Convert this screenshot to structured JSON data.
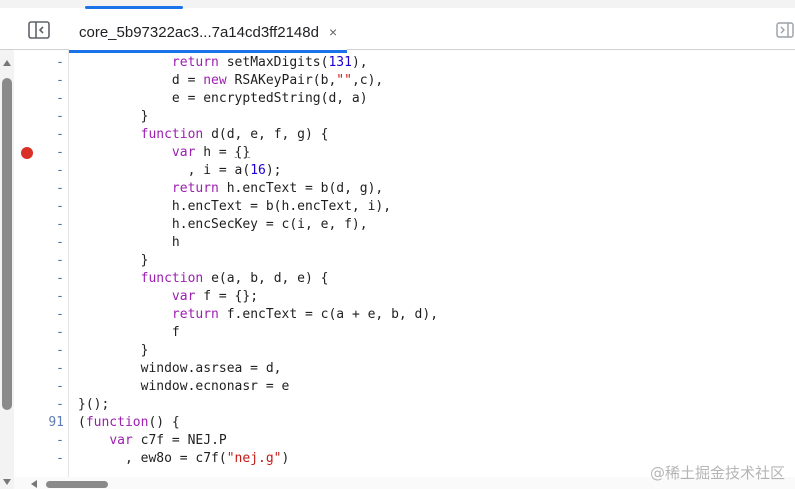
{
  "tab": {
    "file_name": "core_5b97322ac3...7a14cd3ff2148d",
    "close_glyph": "×"
  },
  "icons": {
    "nav_toggle": "sidebar-toggle-icon",
    "nav_toggle_right": "panel-toggle-icon",
    "breakpoint": "breakpoint-marker-icon"
  },
  "colors": {
    "accent": "#1a73e8",
    "breakpoint": "#d93025",
    "keyword": "#9c1fb0",
    "number": "#1c00cf",
    "string": "#c41a16"
  },
  "editor": {
    "lines": [
      {
        "gutter": "-",
        "code": "            return setMaxDigits(131),"
      },
      {
        "gutter": "-",
        "code": "            d = new RSAKeyPair(b,\"\",c),"
      },
      {
        "gutter": "-",
        "code": "            e = encryptedString(d, a)"
      },
      {
        "gutter": "-",
        "code": "        }"
      },
      {
        "gutter": "-",
        "code": "        function d(d, e, f, g) {"
      },
      {
        "gutter": "-",
        "code": "            var h = {}",
        "breakpoint": true
      },
      {
        "gutter": "-",
        "code": "              , i = a(16);"
      },
      {
        "gutter": "-",
        "code": "            return h.encText = b(d, g),"
      },
      {
        "gutter": "-",
        "code": "            h.encText = b(h.encText, i),"
      },
      {
        "gutter": "-",
        "code": "            h.encSecKey = c(i, e, f),"
      },
      {
        "gutter": "-",
        "code": "            h"
      },
      {
        "gutter": "-",
        "code": "        }"
      },
      {
        "gutter": "-",
        "code": "        function e(a, b, d, e) {"
      },
      {
        "gutter": "-",
        "code": "            var f = {};"
      },
      {
        "gutter": "-",
        "code": "            return f.encText = c(a + e, b, d),"
      },
      {
        "gutter": "-",
        "code": "            f"
      },
      {
        "gutter": "-",
        "code": "        }"
      },
      {
        "gutter": "-",
        "code": "        window.asrsea = d,"
      },
      {
        "gutter": "-",
        "code": "        window.ecnonasr = e"
      },
      {
        "gutter": "-",
        "code": "}();"
      },
      {
        "gutter": "91",
        "code": "(function() {"
      },
      {
        "gutter": "-",
        "code": "    var c7f = NEJ.P"
      },
      {
        "gutter": "-",
        "code": "      , ew8o = c7f(\"nej.g\")"
      }
    ]
  },
  "watermark": "@稀土掘金技术社区"
}
